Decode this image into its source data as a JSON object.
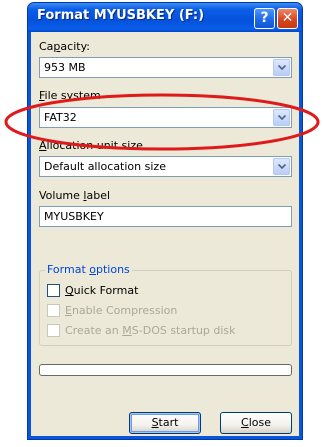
{
  "window": {
    "title": "Format MYUSBKEY (F:)",
    "help_glyph": "?",
    "close_glyph": "✕"
  },
  "capacity": {
    "label_pre": "Ca",
    "label_key": "p",
    "label_post": "acity:",
    "value": "953 MB"
  },
  "file_system": {
    "label_pre": "",
    "label_key": "F",
    "label_post": "ile system",
    "value": "FAT32"
  },
  "allocation": {
    "label_pre": "",
    "label_key": "A",
    "label_post": "llocation unit size",
    "value": "Default allocation size"
  },
  "volume_label": {
    "label_pre": "Volume ",
    "label_key": "l",
    "label_post": "abel",
    "value": "MYUSBKEY"
  },
  "format_options": {
    "legend_pre": "Format ",
    "legend_key": "o",
    "legend_post": "ptions",
    "quick_format": {
      "pre": "",
      "key": "Q",
      "post": "uick Format",
      "checked": false,
      "enabled": true
    },
    "enable_compression": {
      "pre": "",
      "key": "E",
      "post": "nable Compression",
      "checked": false,
      "enabled": false
    },
    "msdos_startup": {
      "pre": "Create an ",
      "key": "M",
      "post": "S-DOS startup disk",
      "checked": false,
      "enabled": false
    }
  },
  "progress": {
    "value": 0
  },
  "buttons": {
    "start_key": "S",
    "start_post": "tart",
    "close_key": "C",
    "close_post": "lose"
  },
  "colors": {
    "titlebar": "#0a5ee8",
    "dialog_bg": "#ece9d8",
    "group_legend": "#0046d5",
    "annotation_circle": "#e01a1a"
  },
  "icons": {
    "dropdown": "chevron-down-icon",
    "help": "help-icon",
    "close": "close-icon"
  }
}
